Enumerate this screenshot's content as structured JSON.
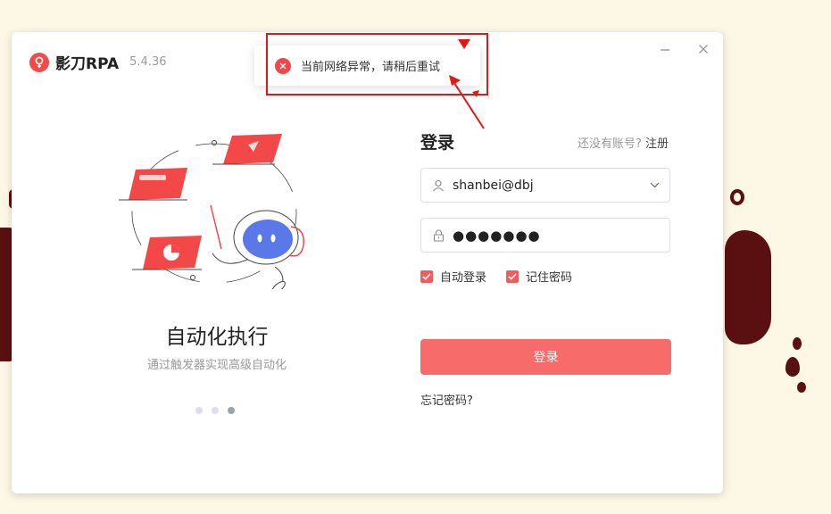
{
  "window": {
    "app_name": "影刀RPA",
    "version": "5.4.36",
    "minimize_icon": "minimize-icon",
    "close_icon": "close-icon"
  },
  "carousel": {
    "title": "自动化执行",
    "subtitle": "通过触发器实现高级自动化",
    "slide_count": 3,
    "active_index": 2
  },
  "login": {
    "title": "登录",
    "register_prompt": "还没有账号?",
    "register_link": "注册",
    "username": "shanbei@dbj",
    "password_masked": "●●●●●●●",
    "auto_login_label": "自动登录",
    "auto_login_checked": true,
    "remember_password_label": "记住密码",
    "remember_password_checked": true,
    "submit_label": "登录",
    "forgot_password": "忘记密码?"
  },
  "toast": {
    "message": "当前网络异常，请稍后重试",
    "icon": "error-icon"
  },
  "colors": {
    "accent": "#f25c5c",
    "button": "#f76b6b",
    "annotation": "#e01818",
    "background": "#fdf8e6"
  }
}
